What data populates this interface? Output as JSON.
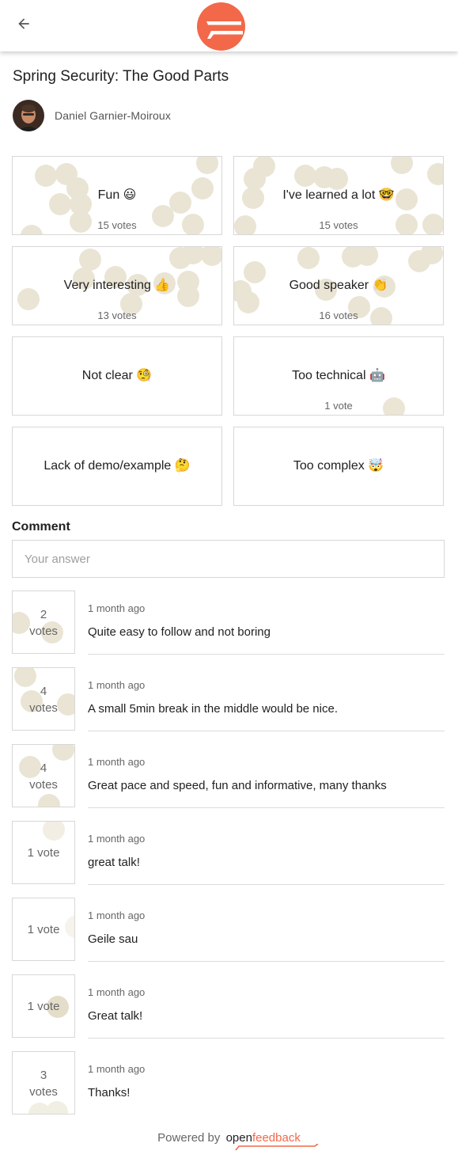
{
  "talk": {
    "title": "Spring Security: The Good Parts",
    "speaker": "Daniel Garnier-Moiroux"
  },
  "vote_items": [
    {
      "label": "Fun 😃",
      "votes": "15 votes"
    },
    {
      "label": "I've learned a lot 🤓",
      "votes": "15 votes"
    },
    {
      "label": "Very interesting 👍",
      "votes": "13 votes"
    },
    {
      "label": "Good speaker 👏",
      "votes": "16 votes"
    },
    {
      "label": "Not clear 🧐",
      "votes": ""
    },
    {
      "label": "Too technical 🤖",
      "votes": "1 vote"
    },
    {
      "label": "Lack of demo/example 🤔",
      "votes": ""
    },
    {
      "label": "Too complex 🤯",
      "votes": ""
    }
  ],
  "comment_section": {
    "heading": "Comment",
    "placeholder": "Your answer"
  },
  "comments": [
    {
      "votes_num": "2",
      "votes_unit": "votes",
      "date": "1 month ago",
      "text": "Quite easy to follow and not boring"
    },
    {
      "votes_num": "4",
      "votes_unit": "votes",
      "date": "1 month ago",
      "text": "A small 5min break in the middle would be nice."
    },
    {
      "votes_num": "4",
      "votes_unit": "votes",
      "date": "1 month ago",
      "text": "Great pace and speed, fun and informative, many thanks"
    },
    {
      "votes_single": "1 vote",
      "date": "1 month ago",
      "text": "great talk!"
    },
    {
      "votes_single": "1 vote",
      "date": "1 month ago",
      "text": "Geile sau"
    },
    {
      "votes_single": "1 vote",
      "date": "1 month ago",
      "text": "Great talk!"
    },
    {
      "votes_num": "3",
      "votes_unit": "votes",
      "date": "1 month ago",
      "text": "Thanks!"
    }
  ],
  "footer": {
    "powered_by": "Powered by",
    "brand_open": "open",
    "brand_feedback": "feedback"
  },
  "colors": {
    "brand": "#f26849",
    "bubble": "#d9cfb2",
    "border": "#d7d7d7"
  },
  "icons": {
    "back": "arrow-left-icon",
    "logo": "openfeedback-logo-icon"
  }
}
